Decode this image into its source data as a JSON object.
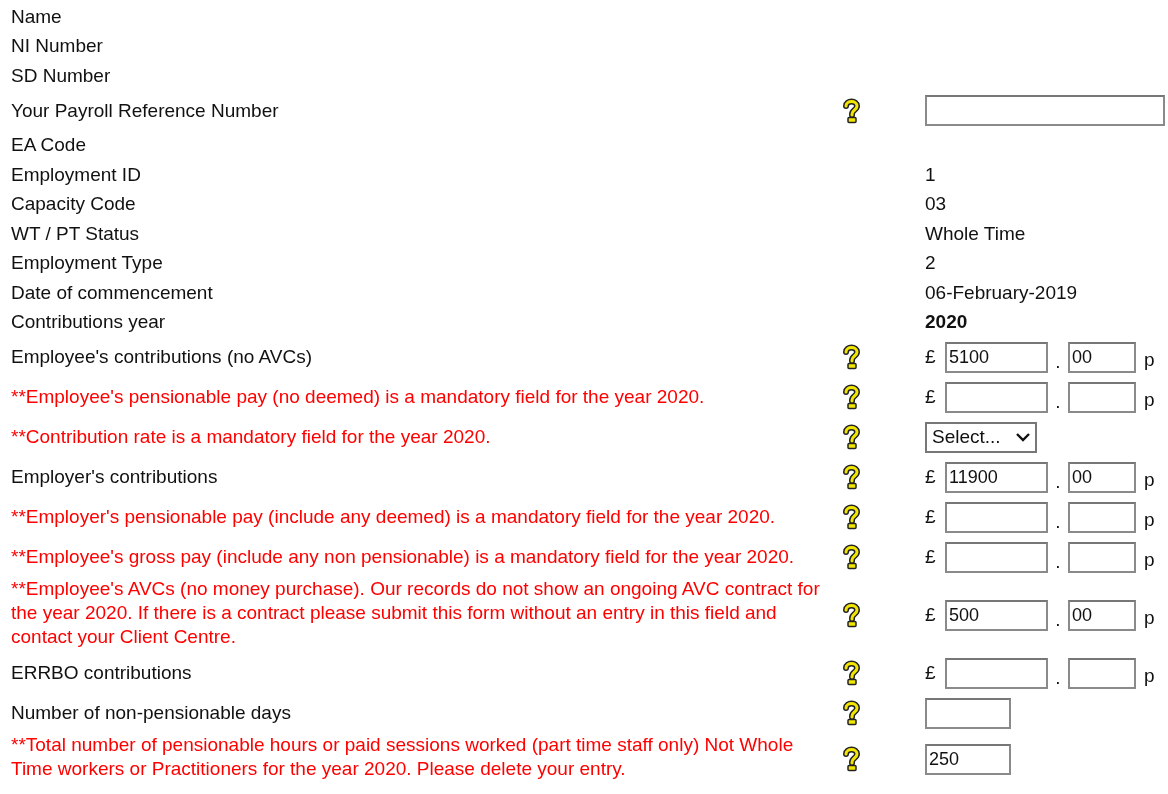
{
  "rows": [
    {
      "kind": "info",
      "label": "Name"
    },
    {
      "kind": "info",
      "label": "NI Number"
    },
    {
      "kind": "info",
      "label": "SD Number"
    },
    {
      "kind": "text",
      "label": "Your Payroll Reference Number",
      "help": true
    },
    {
      "kind": "info",
      "label": "EA Code"
    },
    {
      "kind": "info",
      "label": "Employment ID",
      "value": "1"
    },
    {
      "kind": "info",
      "label": "Capacity Code",
      "value": "03"
    },
    {
      "kind": "info",
      "label": "WT / PT Status",
      "value": "Whole Time"
    },
    {
      "kind": "info",
      "label": "Employment Type",
      "value": "2"
    },
    {
      "kind": "info",
      "label": "Date of commencement",
      "value": "06-February-2019"
    },
    {
      "kind": "info",
      "label": "Contributions year",
      "value": "2020",
      "bold": true
    },
    {
      "kind": "money",
      "label": "Employee's contributions (no AVCs)",
      "help": true,
      "currency": "£",
      "pounds": "5100",
      "separator": ".",
      "pence": "00",
      "unit": "p"
    },
    {
      "kind": "money",
      "label": "**Employee's pensionable pay (no deemed) is a mandatory field for the year 2020.",
      "error": true,
      "help": true,
      "currency": "£",
      "separator": ".",
      "unit": "p"
    },
    {
      "kind": "select",
      "label": "**Contribution rate is a mandatory field for the year 2020.",
      "error": true,
      "help": true,
      "value": "Select..."
    },
    {
      "kind": "money",
      "label": "Employer's contributions",
      "help": true,
      "currency": "£",
      "pounds": "11900",
      "separator": ".",
      "pence": "00",
      "unit": "p"
    },
    {
      "kind": "money",
      "label": "**Employer's pensionable pay (include any deemed) is a mandatory field for the year 2020.",
      "error": true,
      "help": true,
      "currency": "£",
      "separator": ".",
      "unit": "p"
    },
    {
      "kind": "money",
      "label": "**Employee's gross pay (include any non pensionable) is a mandatory field for the year 2020.",
      "error": true,
      "help": true,
      "currency": "£",
      "separator": ".",
      "unit": "p"
    },
    {
      "kind": "money",
      "label": "**Employee's AVCs (no money purchase). Our records do not show an ongoing AVC contract for the year 2020. If there is a contract please submit this form without an entry in this field and contact your Client Centre.",
      "error": true,
      "help": true,
      "currency": "£",
      "pounds": "500",
      "separator": ".",
      "pence": "00",
      "unit": "p"
    },
    {
      "kind": "money",
      "label": "ERRBO contributions",
      "help": true,
      "currency": "£",
      "separator": ".",
      "unit": "p"
    },
    {
      "kind": "small",
      "label": "Number of non-pensionable days",
      "help": true
    },
    {
      "kind": "small",
      "label": "**Total number of pensionable hours or paid sessions worked (part time staff only) Not Whole Time workers or Practitioners for the year 2020. Please delete your entry.",
      "error": true,
      "help": true,
      "value": "250"
    }
  ]
}
